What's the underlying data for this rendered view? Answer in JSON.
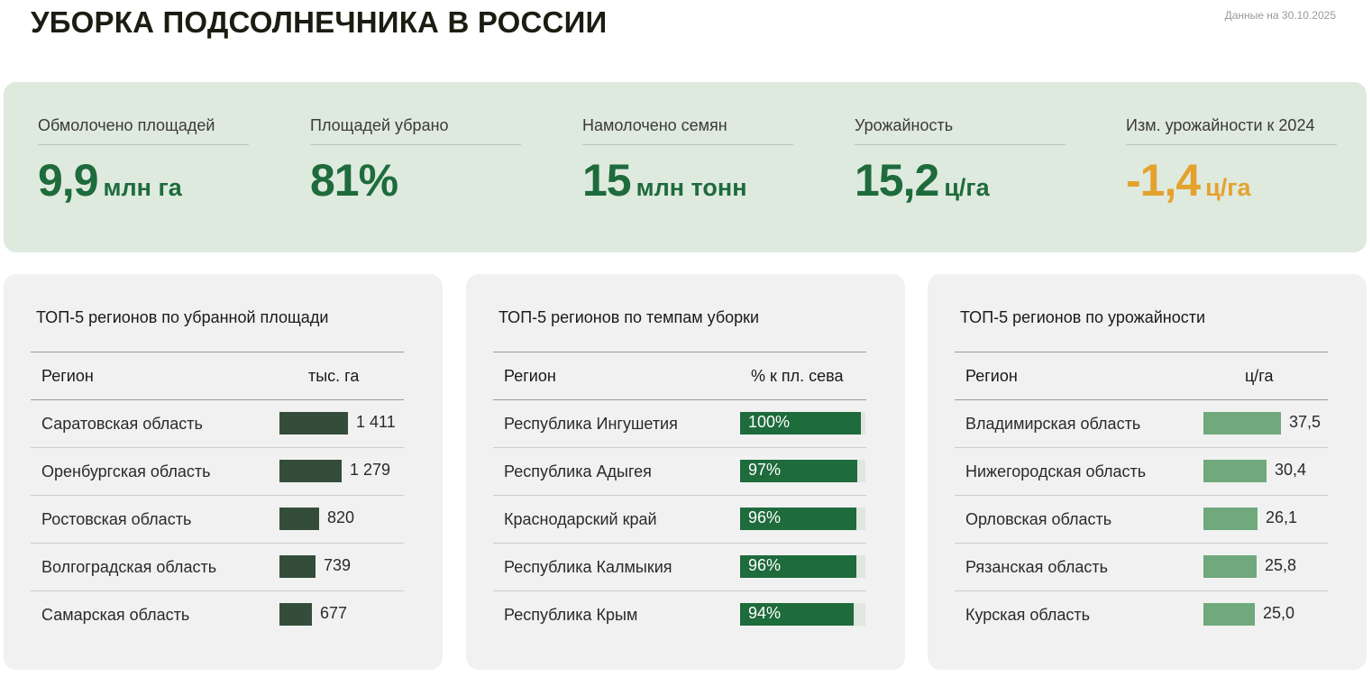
{
  "header": {
    "title": "УБОРКА ПОДСОЛНЕЧНИКА В РОССИИ",
    "as_of": "Данные на 30.10.2025"
  },
  "colors": {
    "accent_green": "#1e6b3c",
    "warning_orange": "#e4a22e",
    "bar_area": "#344d3a",
    "bar_pace": "#1e6b3c",
    "bar_yield": "#6fa97c"
  },
  "kpis": [
    {
      "label": "Обмолочено площадей",
      "value": "9,9",
      "unit": "млн га"
    },
    {
      "label": "Площадей убрано",
      "value": "81%",
      "unit": ""
    },
    {
      "label": "Намолочено семян",
      "value": "15",
      "unit": "млн тонн"
    },
    {
      "label": "Урожайность",
      "value": "15,2",
      "unit": "ц/га"
    },
    {
      "label": "Изм. урожайности к 2024",
      "value": "-1,4",
      "unit": "ц/га"
    }
  ],
  "chart_data": [
    {
      "type": "bar",
      "title": "ТОП-5 регионов по убранной площади",
      "region_header": "Регион",
      "value_header": "тыс. га",
      "categories": [
        "Саратовская область",
        "Оренбургская область",
        "Ростовская область",
        "Волгоградская область",
        "Самарская область"
      ],
      "values": [
        1411,
        1279,
        820,
        739,
        677
      ],
      "labels": [
        "1 411",
        "1 279",
        "820",
        "739",
        "677"
      ],
      "max": 1411
    },
    {
      "type": "bar",
      "title": "ТОП-5 регионов по темпам уборки",
      "region_header": "Регион",
      "value_header": "% к пл. сева",
      "categories": [
        "Республика Ингушетия",
        "Республика Адыгея",
        "Краснодарский край",
        "Республика Калмыкия",
        "Республика Крым"
      ],
      "values": [
        100,
        97,
        96,
        96,
        94
      ],
      "labels": [
        "100%",
        "97%",
        "96%",
        "96%",
        "94%"
      ],
      "max": 100
    },
    {
      "type": "bar",
      "title": "ТОП-5 регионов по урожайности",
      "region_header": "Регион",
      "value_header": "ц/га",
      "categories": [
        "Владимирская область",
        "Нижегородская область",
        "Орловская область",
        "Рязанская область",
        "Курская область"
      ],
      "values": [
        37.5,
        30.4,
        26.1,
        25.8,
        25.0
      ],
      "labels": [
        "37,5",
        "30,4",
        "26,1",
        "25,8",
        "25,0"
      ],
      "max": 37.5
    }
  ]
}
